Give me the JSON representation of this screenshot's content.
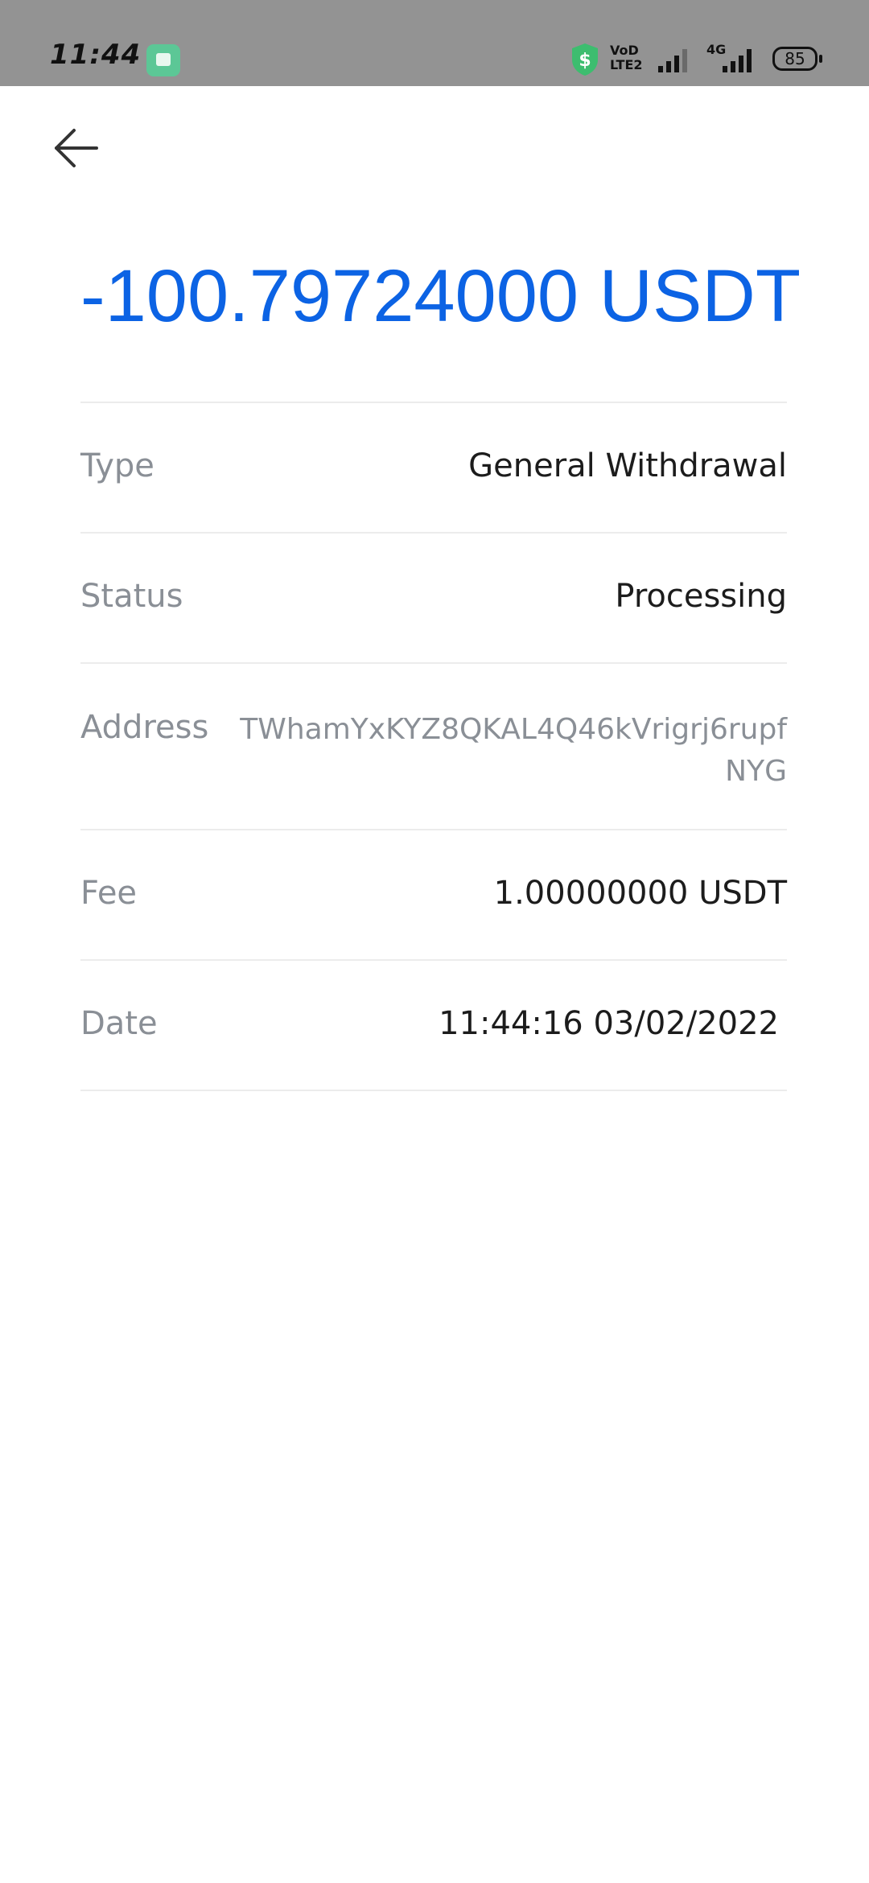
{
  "status_bar": {
    "time": "11:44",
    "network_label_top": "VoD",
    "network_label_bottom": "LTE2",
    "network_type": "4G",
    "battery": "85"
  },
  "transaction": {
    "amount": "-100.79724000 USDT",
    "amount_color": "#0c63e4",
    "rows": {
      "type": {
        "label": "Type",
        "value": "General Withdrawal"
      },
      "status": {
        "label": "Status",
        "value": "Processing"
      },
      "address": {
        "label": "Address",
        "value": "TWhamYxKYZ8QKAL4Q46kVrigrj6rupfNYG"
      },
      "fee": {
        "label": "Fee",
        "value": "1.00000000 USDT"
      },
      "date": {
        "label": "Date",
        "value": "11:44:16 03/02/2022"
      }
    }
  }
}
